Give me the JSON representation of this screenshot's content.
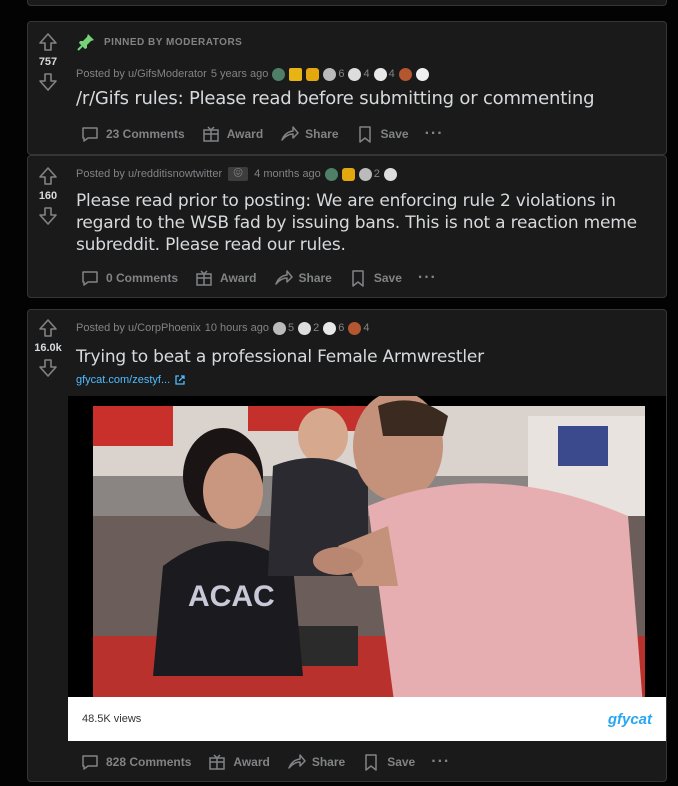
{
  "posts": [
    {
      "pinned_label": "PINNED BY MODERATORS",
      "score": "757",
      "posted_by": "Posted by u/GifsModerator",
      "time": "5 years ago",
      "awards": [
        {
          "icon": "shield-award-icon",
          "color": "#4f7f67",
          "count": ""
        },
        {
          "icon": "gold-award-icon",
          "color": "#e8b413",
          "count": ""
        },
        {
          "icon": "lock-award-icon",
          "color": "#e3a80e",
          "count": ""
        },
        {
          "icon": "hands-award-icon",
          "color": "#bbbbbb",
          "count": "6"
        },
        {
          "icon": "face-award-icon",
          "color": "#dddddd",
          "count": "4"
        },
        {
          "icon": "silver-award-icon",
          "color": "#e8e8e8",
          "count": "4"
        },
        {
          "icon": "poop-award-icon",
          "color": "#b4562f",
          "count": ""
        },
        {
          "icon": "emoji-award-icon",
          "color": "#f0f0f0",
          "count": ""
        }
      ],
      "title": "/r/Gifs rules: Please read before submitting or commenting",
      "comments": "23 Comments",
      "award_label": "Award",
      "share_label": "Share",
      "save_label": "Save"
    },
    {
      "score": "160",
      "posted_by": "Posted by u/redditisnowtwitter",
      "time": "4 months ago",
      "awards": [
        {
          "icon": "shield-award-icon",
          "color": "#4f7f67",
          "count": ""
        },
        {
          "icon": "lock-award-icon",
          "color": "#e3a80e",
          "count": ""
        },
        {
          "icon": "hands-award-icon",
          "color": "#bbbbbb",
          "count": "2"
        },
        {
          "icon": "face-award-icon",
          "color": "#dddddd",
          "count": ""
        }
      ],
      "title_lines": [
        "Please read prior to posting: We are enforcing rule 2 violations in",
        "regard to the WSB fad by issuing bans. This is not a reaction meme",
        "subreddit. Please read our rules."
      ],
      "comments": "0 Comments",
      "award_label": "Award",
      "share_label": "Share",
      "save_label": "Save"
    },
    {
      "score": "16.0k",
      "posted_by": "Posted by u/CorpPhoenix",
      "time": "10 hours ago",
      "awards": [
        {
          "icon": "hands-award-icon",
          "color": "#bbbbbb",
          "count": "5"
        },
        {
          "icon": "face-award-icon",
          "color": "#dddddd",
          "count": "2"
        },
        {
          "icon": "silver-award-icon",
          "color": "#e8e8e8",
          "count": "6"
        },
        {
          "icon": "poop-award-icon",
          "color": "#b4562f",
          "count": "4"
        }
      ],
      "title": "Trying to beat a professional Female Armwrestler",
      "link": "gfycat.com/zestyf...",
      "views": "48.5K views",
      "gfycat_logo": "gfycat",
      "comments": "828 Comments",
      "award_label": "Award",
      "share_label": "Share",
      "save_label": "Save"
    }
  ],
  "colors": {
    "background": "#030303",
    "card": "#1a1a1b",
    "border": "#343536",
    "text": "#d7dadc",
    "muted": "#818384",
    "link": "#4fbcff"
  }
}
